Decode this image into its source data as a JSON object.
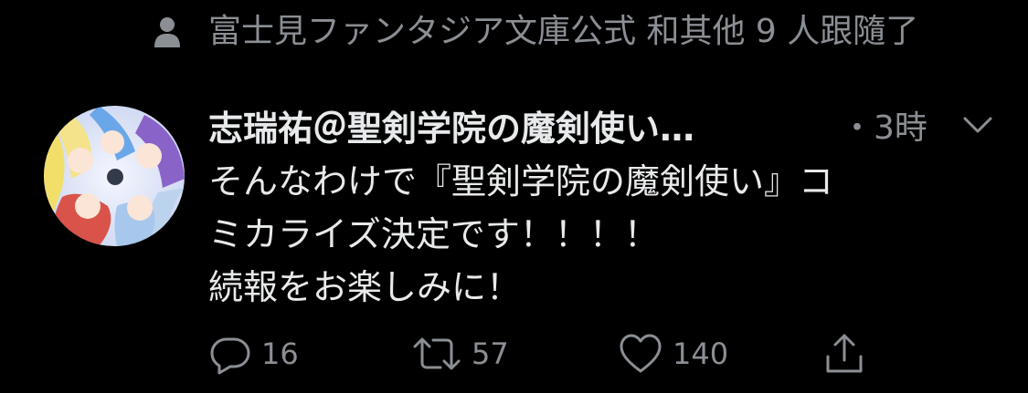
{
  "context": {
    "icon": "person-icon",
    "text": "富士見ファンタジア文庫公式 和其他 9 人跟隨了"
  },
  "tweet": {
    "avatar_icon": "avatar-illustration",
    "author": "志瑞祐＠聖剣学院の魔剣使い…",
    "time": "・3時",
    "menu_icon": "chevron-down-icon",
    "lines": [
      "そんなわけで『聖剣学院の魔剣使い』コ",
      "ミカライズ決定です！！！！",
      "続報をお楽しみに！"
    ]
  },
  "actions": {
    "reply": {
      "icon": "reply-icon",
      "count": "16"
    },
    "retweet": {
      "icon": "retweet-icon",
      "count": "57"
    },
    "like": {
      "icon": "heart-icon",
      "count": "140"
    },
    "share": {
      "icon": "share-icon"
    }
  },
  "colors": {
    "background": "#000000",
    "primary_text": "#e7e9ea",
    "secondary_text": "#8b8f94"
  }
}
